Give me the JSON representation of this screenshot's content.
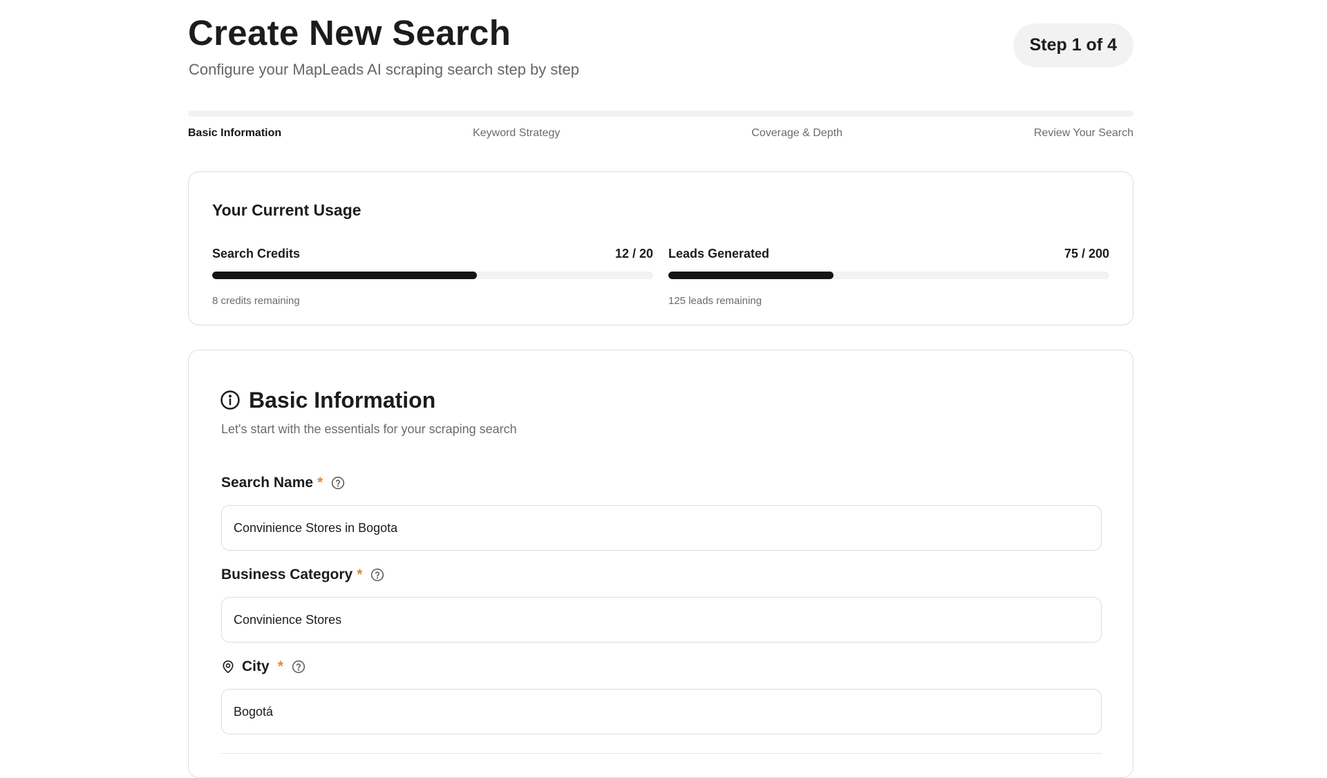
{
  "header": {
    "title": "Create New Search",
    "subtitle": "Configure your MapLeads AI scraping search step by step",
    "step_badge": "Step 1 of 4"
  },
  "stepper": {
    "steps": [
      {
        "label": "Basic Information",
        "active": true
      },
      {
        "label": "Keyword Strategy",
        "active": false
      },
      {
        "label": "Coverage & Depth",
        "active": false
      },
      {
        "label": "Review Your Search",
        "active": false
      }
    ],
    "progress_fraction": 0
  },
  "usage": {
    "title": "Your Current Usage",
    "search_credits": {
      "label": "Search Credits",
      "count": "12 / 20",
      "used": 12,
      "total": 20,
      "note": "8 credits remaining"
    },
    "leads_generated": {
      "label": "Leads Generated",
      "count": "75 / 200",
      "used": 75,
      "total": 200,
      "note": "125 leads remaining"
    }
  },
  "basic_info": {
    "icon": "info-circle-icon",
    "title": "Basic Information",
    "subtitle": "Let's start with the essentials for your scraping search",
    "fields": {
      "search_name": {
        "label": "Search Name",
        "required_mark": "*",
        "value": "Convinience Stores in Bogota"
      },
      "business_category": {
        "label": "Business Category",
        "required_mark": "*",
        "value": "Convinience Stores"
      },
      "city": {
        "label": "City",
        "required_mark": "*",
        "value": "Bogotá",
        "icon": "map-pin-icon"
      }
    }
  },
  "colors": {
    "accent_dark": "#141414",
    "required_mark": "#e0893a",
    "muted_text": "#6b6b6b",
    "border": "#dedede",
    "track": "#f2f2f2"
  }
}
